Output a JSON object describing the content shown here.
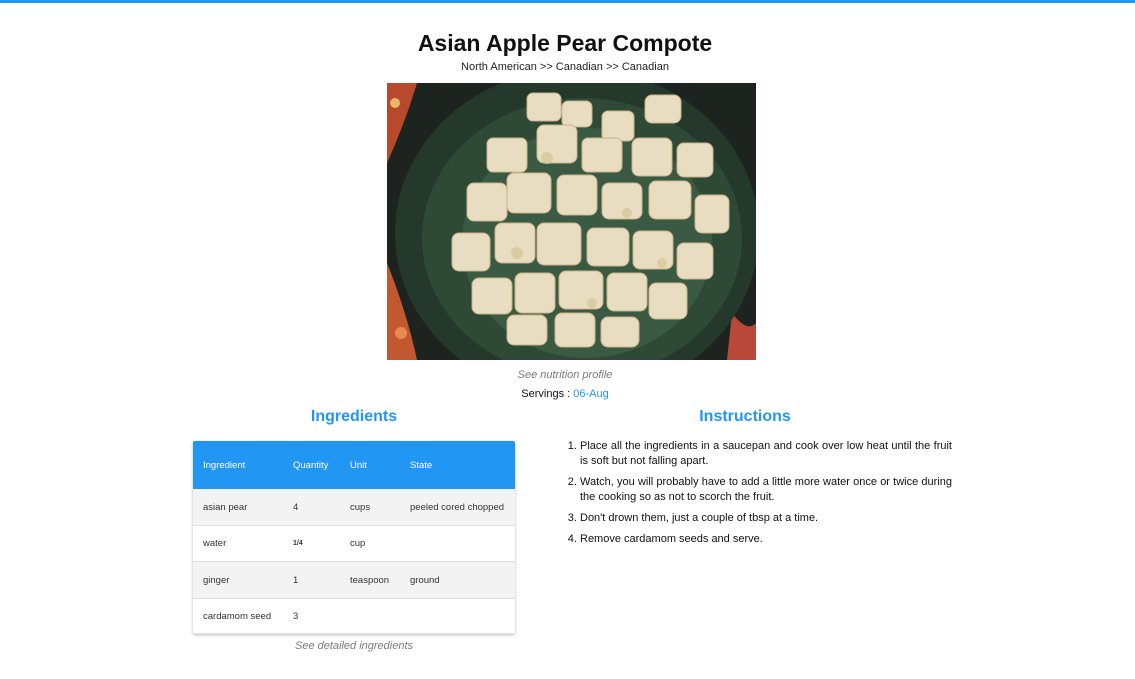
{
  "recipe": {
    "title": "Asian Apple Pear Compote",
    "breadcrumb": "North American >> Canadian >> Canadian",
    "nutrition_link": "See nutrition profile",
    "servings_label": "Servings :",
    "servings_value": "06-Aug"
  },
  "ingredients": {
    "heading": "Ingredients",
    "columns": [
      "Ingredient",
      "Quantity",
      "Unit",
      "State"
    ],
    "rows": [
      {
        "ingredient": "asian pear",
        "quantity": "4",
        "unit": "cups",
        "state": "peeled cored chopped"
      },
      {
        "ingredient": "water",
        "quantity": "1/4",
        "unit": "cup",
        "state": ""
      },
      {
        "ingredient": "ginger",
        "quantity": "1",
        "unit": "teaspoon",
        "state": "ground"
      },
      {
        "ingredient": "cardamom seed",
        "quantity": "3",
        "unit": "",
        "state": ""
      }
    ],
    "detailed_link": "See detailed ingredients"
  },
  "instructions": {
    "heading": "Instructions",
    "steps": [
      "Place all the ingredients in a saucepan and cook over low heat until the fruit is soft but not falling apart.",
      "Watch, you will probably have to add a little more water once or twice during the cooking so as not to scorch the fruit.",
      "Don't drown them, just a couple of tbsp at a time.",
      "Remove cardamom seeds and serve."
    ]
  },
  "colors": {
    "accent": "#2196f3",
    "muted": "#7a7a7a"
  }
}
